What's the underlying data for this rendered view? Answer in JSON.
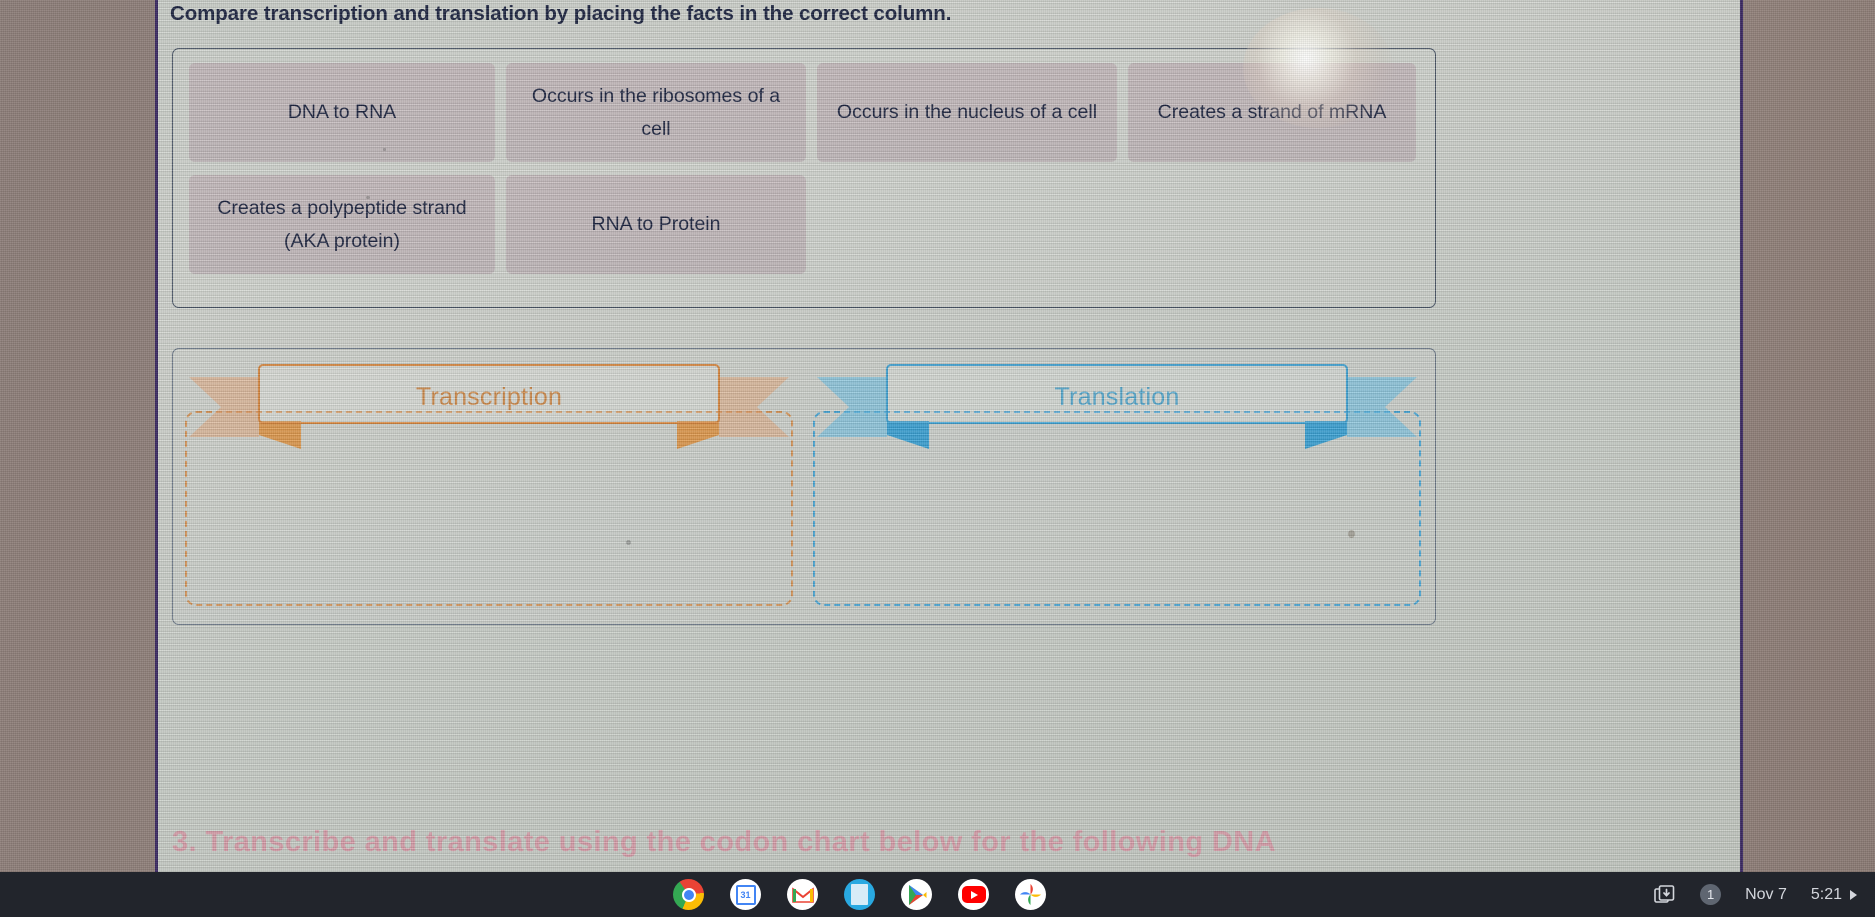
{
  "question": {
    "title": "Compare transcription and translation by placing the facts in the correct column."
  },
  "card_bank": {
    "rows": [
      [
        {
          "label": "DNA to RNA"
        },
        {
          "label": "Occurs in the ribosomes of a cell"
        },
        {
          "label": "Occurs in the nucleus of a cell"
        },
        {
          "label": "Creates a strand of mRNA"
        }
      ],
      [
        {
          "label": "Creates a polypeptide strand (AKA protein)"
        },
        {
          "label": "RNA to Protein"
        }
      ]
    ]
  },
  "columns": [
    {
      "label": "Transcription",
      "color": "#d9975a"
    },
    {
      "label": "Translation",
      "color": "#4aa8d8"
    }
  ],
  "next_question": {
    "text": "3. Transcribe and translate using the codon chart below for the following DNA"
  },
  "shelf": {
    "apps": [
      {
        "name": "chrome"
      },
      {
        "name": "calendar",
        "day": "31"
      },
      {
        "name": "gmail"
      },
      {
        "name": "docs"
      },
      {
        "name": "play-store"
      },
      {
        "name": "youtube"
      },
      {
        "name": "photos"
      }
    ],
    "tray": {
      "notification_count": "1",
      "date": "Nov 7",
      "time": "5:21"
    }
  }
}
